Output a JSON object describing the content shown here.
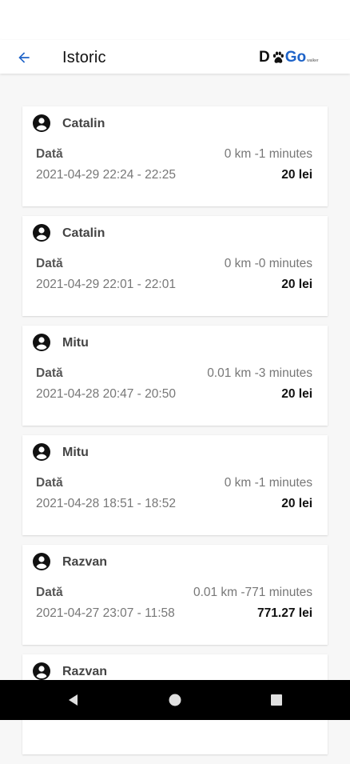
{
  "header": {
    "title": "Istoric",
    "back_icon": "arrow-left-icon",
    "logo_text": {
      "part1": "D",
      "part2": "Go",
      "small": "walker"
    }
  },
  "colors": {
    "accent": "#1e63c8",
    "background": "#f7f7f7",
    "card": "#ffffff"
  },
  "history": [
    {
      "name": "Catalin",
      "label": "Dată",
      "distance": "0 km -1 minutes",
      "date": "2021-04-29 22:24 - 22:25",
      "price": "20 lei"
    },
    {
      "name": "Catalin",
      "label": "Dată",
      "distance": "0 km -0 minutes",
      "date": "2021-04-29 22:01 - 22:01",
      "price": "20 lei"
    },
    {
      "name": "Mitu",
      "label": "Dată",
      "distance": "0.01 km -3 minutes",
      "date": "2021-04-28 20:47 - 20:50",
      "price": "20 lei"
    },
    {
      "name": "Mitu",
      "label": "Dată",
      "distance": "0 km -1 minutes",
      "date": "2021-04-28 18:51 - 18:52",
      "price": "20 lei"
    },
    {
      "name": "Razvan",
      "label": "Dată",
      "distance": "0.01 km -771 minutes",
      "date": "2021-04-27 23:07 - 11:58",
      "price": "771.27 lei"
    },
    {
      "name": "Razvan",
      "label": "",
      "distance": "",
      "date": "",
      "price": ""
    }
  ],
  "navigation": {
    "back": "triangle-back-icon",
    "home": "circle-home-icon",
    "recents": "square-recents-icon"
  }
}
